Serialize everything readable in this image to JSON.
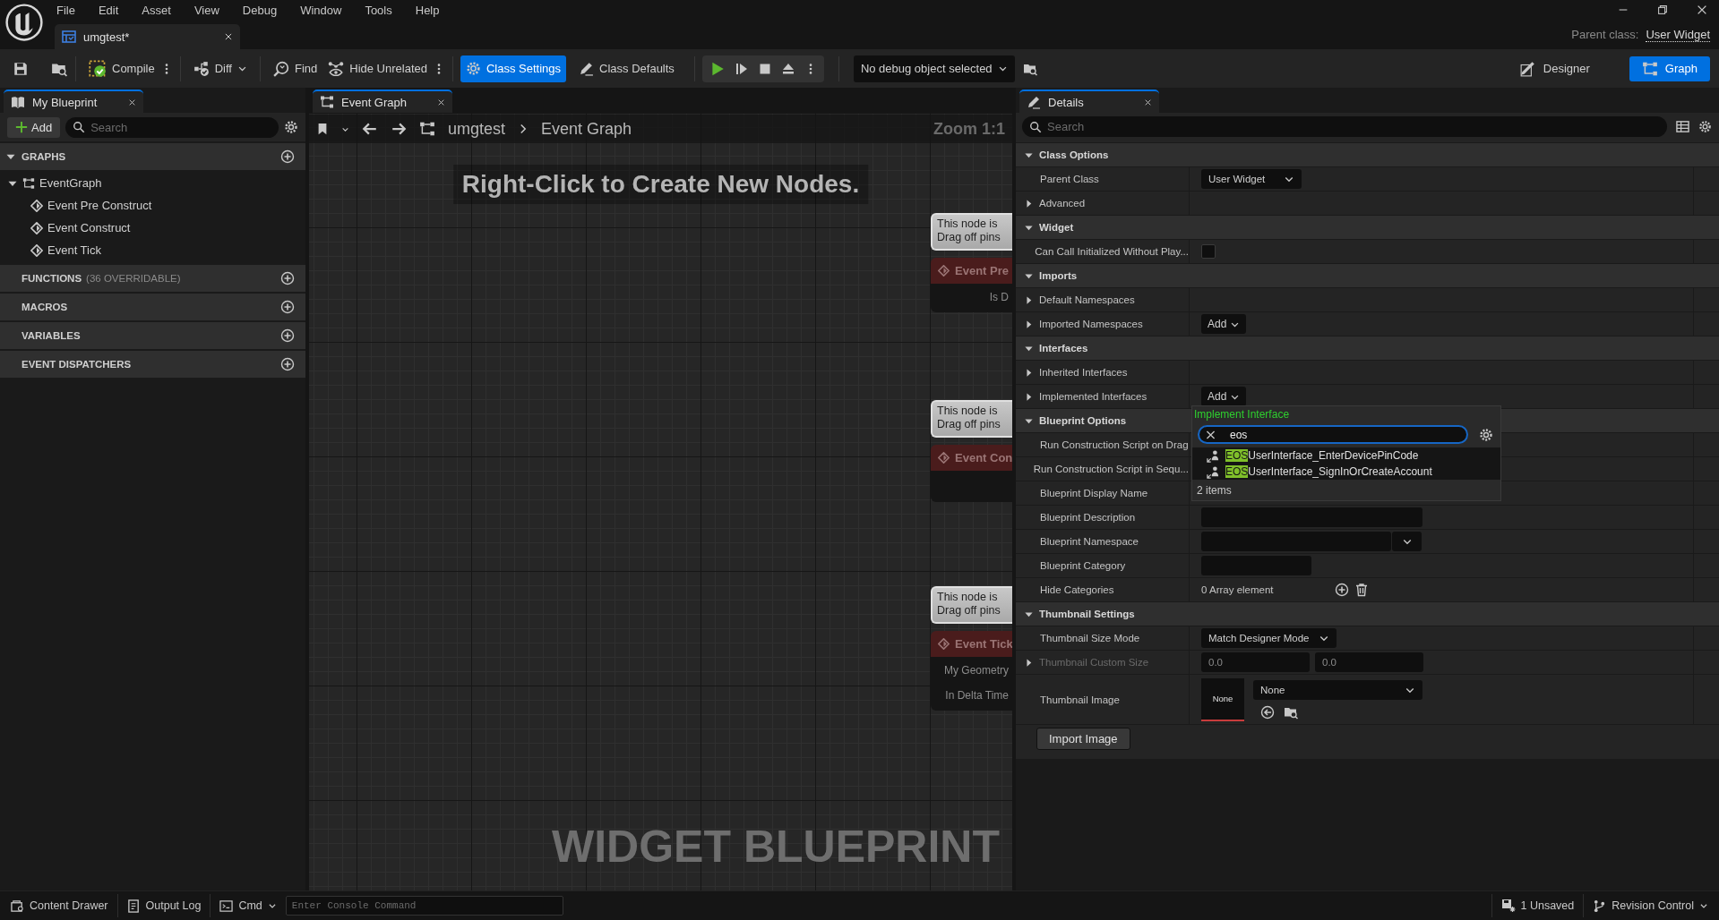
{
  "title_bar": {
    "menu": [
      "File",
      "Edit",
      "Asset",
      "View",
      "Debug",
      "Window",
      "Tools",
      "Help"
    ],
    "document_tab": "umgtest*",
    "parent_class_label": "Parent class:",
    "parent_class": "User Widget"
  },
  "toolbar": {
    "compile": "Compile",
    "diff": "Diff",
    "find": "Find",
    "hide_unrelated": "Hide Unrelated",
    "modes": [
      {
        "label": "Class Settings",
        "selected": true
      },
      {
        "label": "Class Defaults",
        "selected": false
      }
    ],
    "debug_object": "No debug object selected",
    "views": [
      {
        "label": "Designer",
        "selected": false
      },
      {
        "label": "Graph",
        "selected": true
      }
    ]
  },
  "my_blueprint": {
    "tab": "My Blueprint",
    "add": "Add",
    "search": {
      "placeholder": "Search"
    },
    "sections": [
      {
        "title": "GRAPHS",
        "children": [
          {
            "label": "EventGraph",
            "children": [
              {
                "label": "Event Pre Construct"
              },
              {
                "label": "Event Construct"
              },
              {
                "label": "Event Tick"
              }
            ]
          }
        ]
      },
      {
        "title": "FUNCTIONS",
        "note": "(36 OVERRIDABLE)"
      },
      {
        "title": "MACROS"
      },
      {
        "title": "VARIABLES"
      },
      {
        "title": "EVENT DISPATCHERS"
      }
    ]
  },
  "graph": {
    "tab": "Event Graph",
    "breadcrumb": [
      "umgtest",
      "Event Graph"
    ],
    "zoom": "Zoom 1:1",
    "hint": "Right-Click to Create New Nodes.",
    "nodes": [
      {
        "comment": [
          "This node is",
          "Drag off pins"
        ],
        "title": "Event Pre",
        "pins": [
          "Is D"
        ]
      },
      {
        "comment": [
          "This node is",
          "Drag off pins"
        ],
        "title": "Event Con"
      },
      {
        "comment": [
          "This node is",
          "Drag off pins"
        ],
        "title": "Event Tick",
        "pins": [
          "My Geometry",
          "In Delta Time"
        ]
      }
    ],
    "watermark": "WIDGET BLUEPRINT"
  },
  "details": {
    "tab": "Details",
    "search": {
      "placeholder": "Search"
    },
    "sections": [
      {
        "title": "Class Options",
        "expanded": true,
        "rows": [
          {
            "label": "Parent Class",
            "expander": false,
            "disabled": false,
            "kind": "dropdown",
            "value": "User Widget"
          },
          {
            "label": "Advanced",
            "expander": true,
            "disabled": false,
            "kind": "blank"
          }
        ]
      },
      {
        "title": "Widget",
        "expanded": true,
        "rows": [
          {
            "label": "Can Call Initialized Without Play...",
            "expander": false,
            "disabled": false,
            "kind": "checkbox",
            "checked": false
          }
        ]
      },
      {
        "title": "Imports",
        "expanded": true,
        "rows": [
          {
            "label": "Default Namespaces",
            "expander": true,
            "disabled": false,
            "kind": "blank"
          },
          {
            "label": "Imported Namespaces",
            "expander": true,
            "disabled": false,
            "kind": "add",
            "value": "Add"
          }
        ]
      },
      {
        "title": "Interfaces",
        "expanded": true,
        "rows": [
          {
            "label": "Inherited Interfaces",
            "expander": true,
            "disabled": false,
            "kind": "blank"
          },
          {
            "label": "Implemented Interfaces",
            "expander": true,
            "disabled": false,
            "kind": "add",
            "value": "Add",
            "popup": {
              "title": "Implement Interface",
              "query": "eos",
              "results": [
                {
                  "match": "EOS",
                  "rest": "UserInterface_EnterDevicePinCode"
                },
                {
                  "match": "EOS",
                  "rest": "UserInterface_SignInOrCreateAccount"
                }
              ],
              "count": "2 items"
            }
          }
        ]
      },
      {
        "title": "Blueprint Options",
        "expanded": true,
        "rows": [
          {
            "label": "Run Construction Script on Drag",
            "expander": false,
            "disabled": false,
            "kind": "blank"
          },
          {
            "label": "Run Construction Script in Sequ...",
            "expander": false,
            "disabled": false,
            "kind": "blank"
          },
          {
            "label": "Blueprint Display Name",
            "expander": false,
            "disabled": false,
            "kind": "blank"
          },
          {
            "label": "Blueprint Description",
            "expander": false,
            "disabled": false,
            "kind": "field"
          },
          {
            "label": "Blueprint Namespace",
            "expander": false,
            "disabled": false,
            "kind": "combo"
          },
          {
            "label": "Blueprint Category",
            "expander": false,
            "disabled": false,
            "kind": "short"
          },
          {
            "label": "Hide Categories",
            "expander": false,
            "disabled": false,
            "kind": "array",
            "value": "0 Array element"
          }
        ]
      },
      {
        "title": "Thumbnail Settings",
        "expanded": true,
        "rows": [
          {
            "label": "Thumbnail Size Mode",
            "expander": false,
            "disabled": false,
            "kind": "dropdown",
            "value": "Match Designer Mode"
          },
          {
            "label": "Thumbnail Custom Size",
            "expander": true,
            "disabled": true,
            "kind": "pair",
            "values": [
              "0.0",
              "0.0"
            ]
          },
          {
            "label": "Thumbnail Image",
            "expander": false,
            "disabled": false,
            "kind": "thumbnail",
            "preview": "None",
            "value": "None"
          }
        ]
      }
    ],
    "import_button": "Import Image"
  },
  "status_bar": {
    "content_drawer": "Content Drawer",
    "output_log": "Output Log",
    "cmd": "Cmd",
    "console": {
      "placeholder": "Enter Console Command"
    },
    "unsaved": "1 Unsaved",
    "revision_control": "Revision Control"
  }
}
